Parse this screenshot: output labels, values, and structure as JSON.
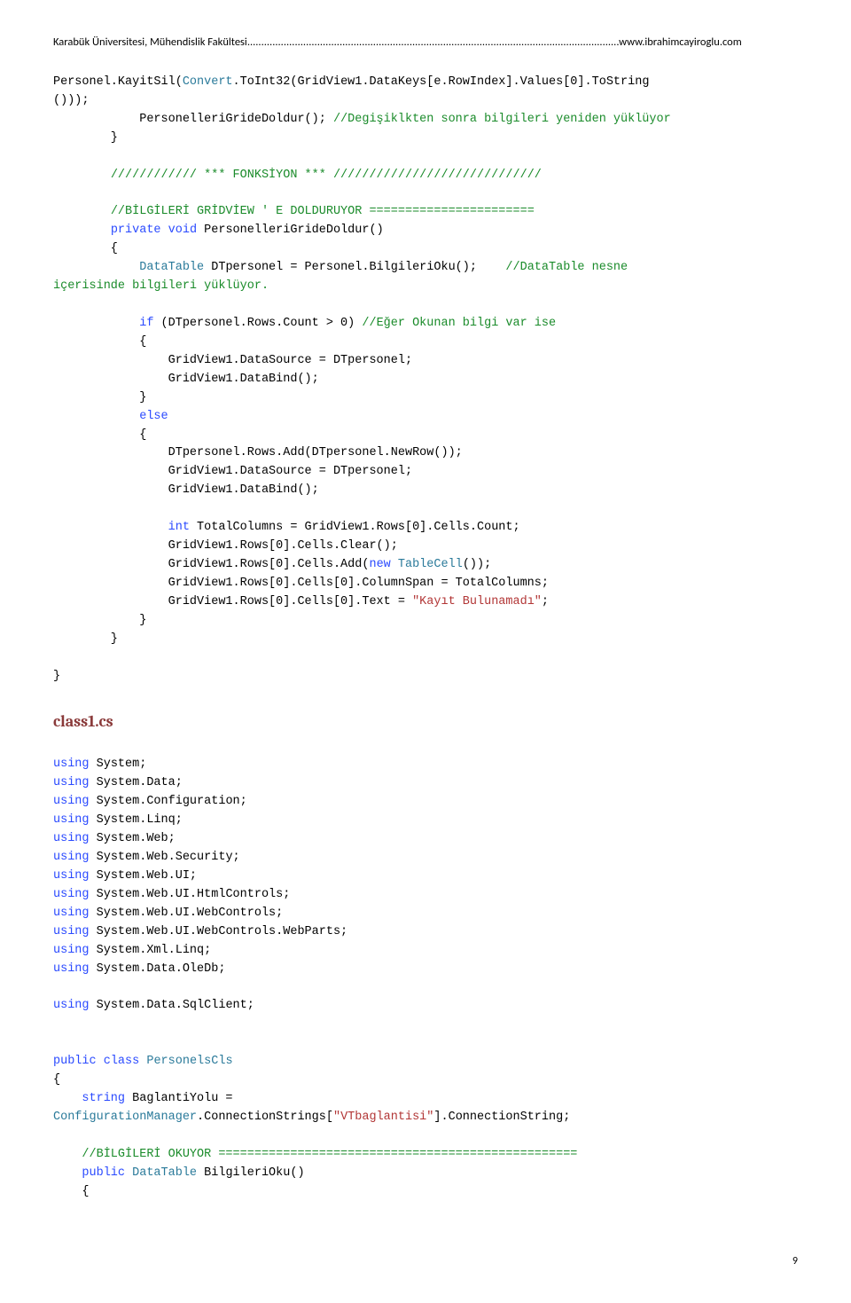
{
  "header": {
    "left": "Karabük Üniversitesi, Mühendislik Fakültesi",
    "dots": ".....................................................................................................................................",
    "right": "www.ibrahimcayiroglu.com"
  },
  "code1": {
    "l1a": "Personel.KayitSil(",
    "l1b": "Convert",
    "l1c": ".ToInt32(GridView1.DataKeys[e.RowIndex].Values[0].ToString",
    "l2": "()));",
    "l3a": "            PersonelleriGrideDoldur(); ",
    "l3b": "//Degişiklkten sonra bilgileri yeniden yüklüyor",
    "l4": "        }",
    "blank": "",
    "l5a": "        ",
    "l5b": "//////////// *** FONKSİYON *** /////////////////////////////",
    "l6a": "        ",
    "l6b": "//BİLGİLERİ GRİDVİEW ' E DOLDURUYOR =======================",
    "l7a": "        ",
    "l7b": "private",
    "l7c": " ",
    "l7d": "void",
    "l7e": " PersonelleriGrideDoldur()",
    "l8": "        {",
    "l9a": "            ",
    "l9b": "DataTable",
    "l9c": " DTpersonel = Personel.BilgileriOku();    ",
    "l9d": "//DataTable nesne",
    "l10": "içerisinde bilgileri yüklüyor.",
    "l11a": "            ",
    "l11b": "if",
    "l11c": " (DTpersonel.Rows.Count > 0) ",
    "l11d": "//Eğer Okunan bilgi var ise",
    "l12": "            {",
    "l13": "                GridView1.DataSource = DTpersonel;",
    "l14": "                GridView1.DataBind();",
    "l15": "            }",
    "l16a": "            ",
    "l16b": "else",
    "l17": "            {",
    "l18": "                DTpersonel.Rows.Add(DTpersonel.NewRow());",
    "l19": "                GridView1.DataSource = DTpersonel;",
    "l20": "                GridView1.DataBind();",
    "l21a": "                ",
    "l21b": "int",
    "l21c": " TotalColumns = GridView1.Rows[0].Cells.Count;",
    "l22": "                GridView1.Rows[0].Cells.Clear();",
    "l23a": "                GridView1.Rows[0].Cells.Add(",
    "l23b": "new",
    "l23c": " ",
    "l23d": "TableCell",
    "l23e": "());",
    "l24": "                GridView1.Rows[0].Cells[0].ColumnSpan = TotalColumns;",
    "l25a": "                GridView1.Rows[0].Cells[0].Text = ",
    "l25b": "\"Kayıt Bulunamadı\"",
    "l25c": ";",
    "l26": "            }",
    "l27": "        }",
    "l28": "}"
  },
  "heading": "class1.cs",
  "code2": {
    "u1a": "using",
    "u1b": " System;",
    "u2a": "using",
    "u2b": " System.Data;",
    "u3a": "using",
    "u3b": " System.Configuration;",
    "u4a": "using",
    "u4b": " System.Linq;",
    "u5a": "using",
    "u5b": " System.Web;",
    "u6a": "using",
    "u6b": " System.Web.Security;",
    "u7a": "using",
    "u7b": " System.Web.UI;",
    "u8a": "using",
    "u8b": " System.Web.UI.HtmlControls;",
    "u9a": "using",
    "u9b": " System.Web.UI.WebControls;",
    "u10a": "using",
    "u10b": " System.Web.UI.WebControls.WebParts;",
    "u11a": "using",
    "u11b": " System.Xml.Linq;",
    "u12a": "using",
    "u12b": " System.Data.OleDb;",
    "u13a": "using",
    "u13b": " System.Data.SqlClient;",
    "blank": "",
    "c1a": "public",
    "c1b": " ",
    "c1c": "class",
    "c1d": " ",
    "c1e": "PersonelsCls",
    "c2": "{",
    "c3a": "    ",
    "c3b": "string",
    "c3c": " BaglantiYolu =",
    "c4a": "ConfigurationManager",
    "c4b": ".ConnectionStrings[",
    "c4c": "\"VTbaglantisi\"",
    "c4d": "].ConnectionString;",
    "c5a": "    ",
    "c5b": "//BİLGİLERİ OKUYOR ==================================================",
    "c6a": "    ",
    "c6b": "public",
    "c6c": " ",
    "c6d": "DataTable",
    "c6e": " BilgileriOku()",
    "c7": "    {"
  },
  "pageNumber": "9"
}
